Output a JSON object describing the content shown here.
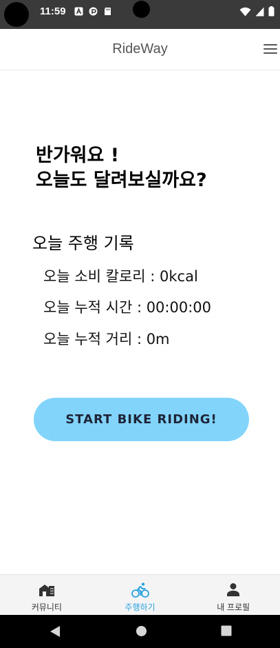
{
  "status_bar": {
    "time": "11:59"
  },
  "header": {
    "title": "RideWay"
  },
  "greeting": {
    "line1": "반가워요 !",
    "line2": "오늘도 달려보실까요?"
  },
  "today_record": {
    "heading": "오늘 주행 기록",
    "calories": "오늘 소비 칼로리 : 0kcal",
    "time": "오늘 누적 시간 : 00:00:00",
    "distance": "오늘 누적 거리 : 0m"
  },
  "start_button": {
    "label": "START BIKE RIDING!"
  },
  "bottom_nav": {
    "items": [
      {
        "label": "커뮤니티",
        "icon": "community-icon"
      },
      {
        "label": "주행하기",
        "icon": "bike-icon"
      },
      {
        "label": "내 프로필",
        "icon": "person-icon"
      }
    ],
    "active_index": 1
  },
  "colors": {
    "accent": "#2aa3e0",
    "button": "#82d4fb",
    "status_bar": "#3a3a3a"
  }
}
